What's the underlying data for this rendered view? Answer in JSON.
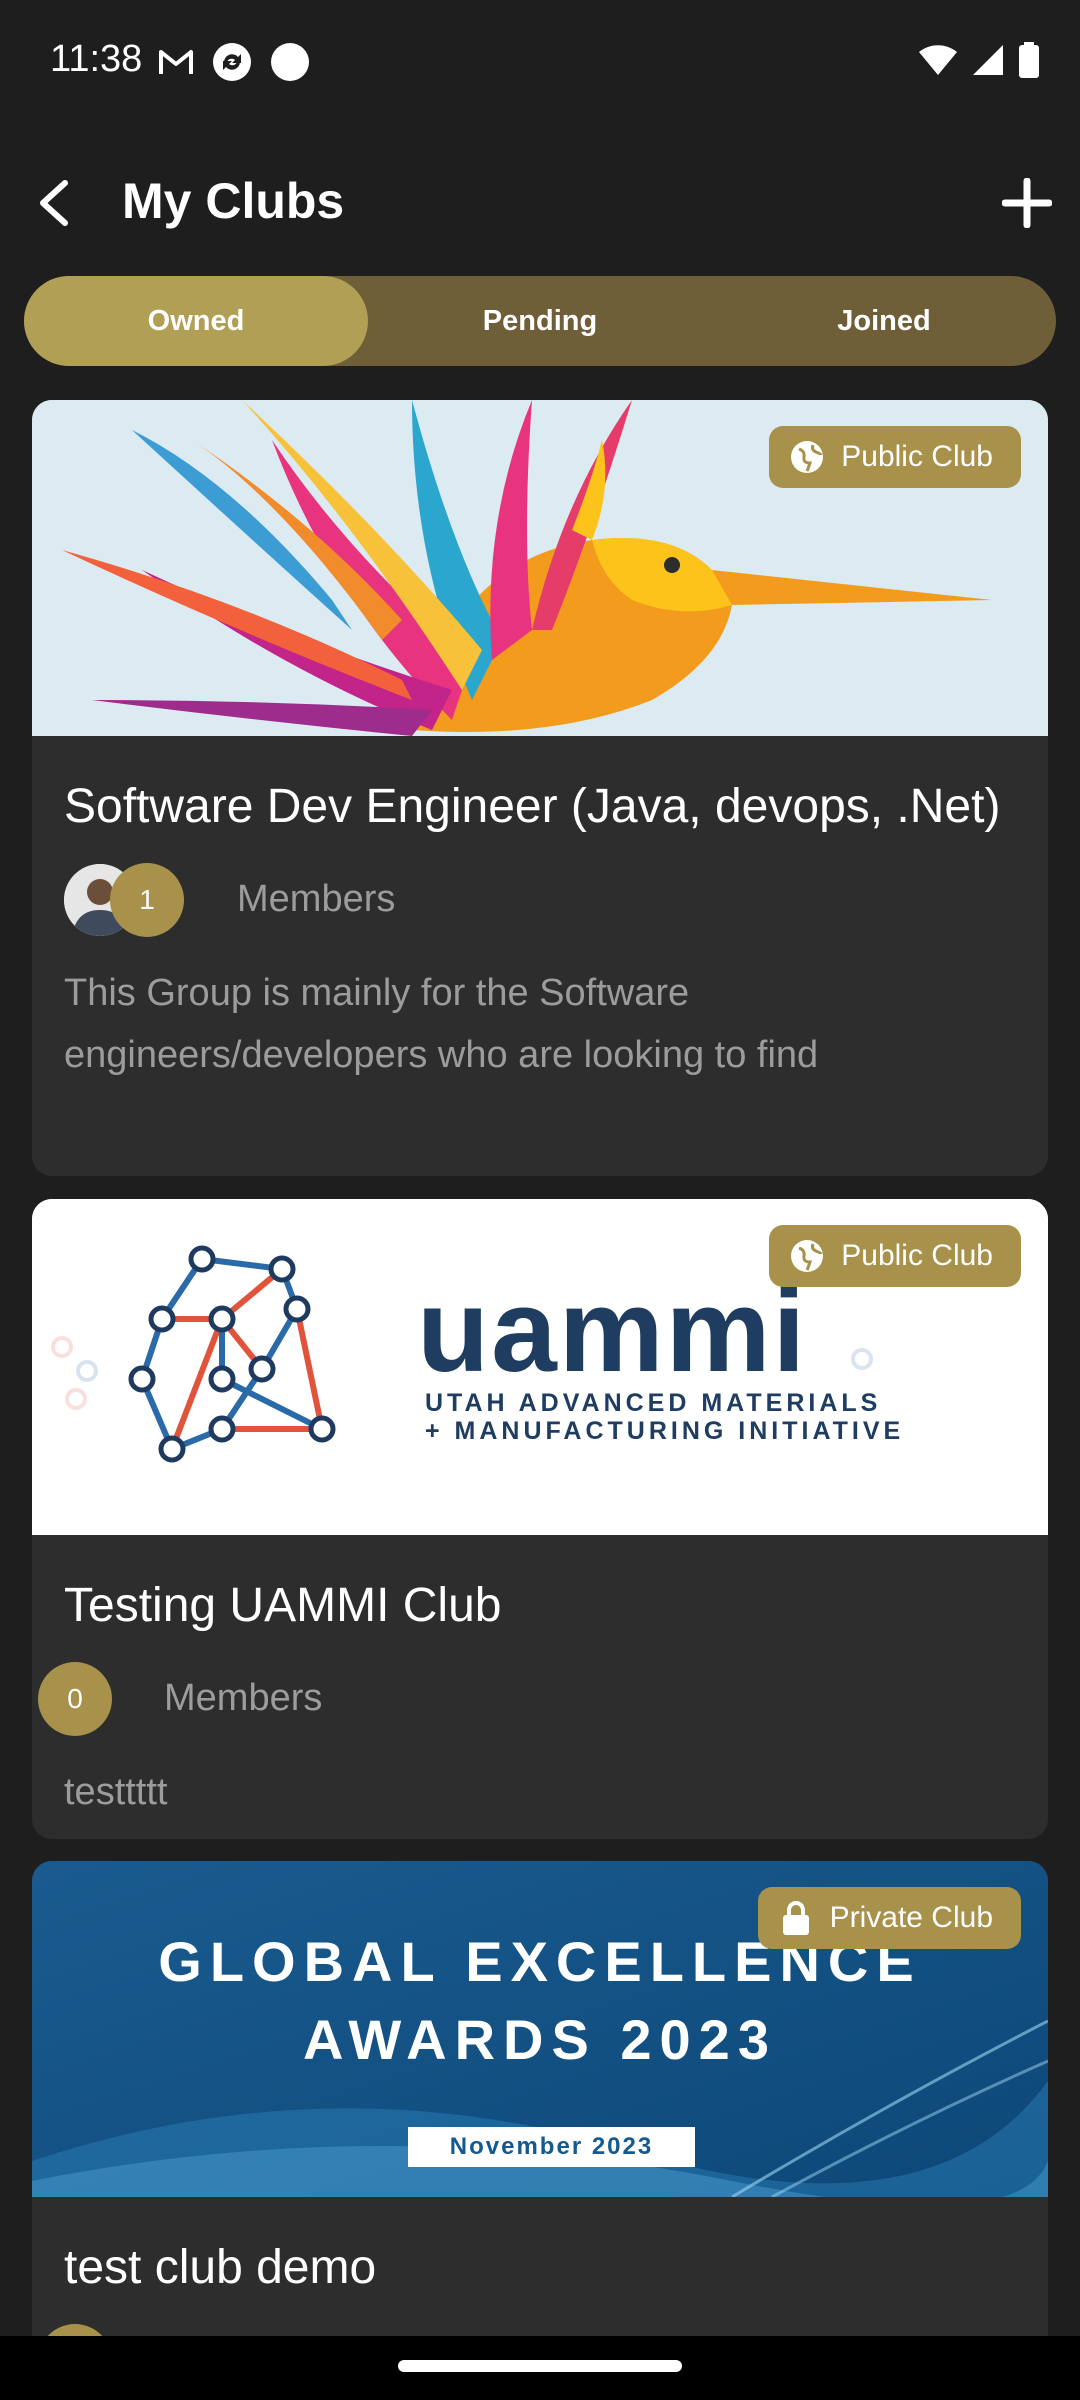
{
  "status_bar": {
    "time": "11:38",
    "left_icons": [
      "gmail-icon",
      "sync-icon",
      "dot-icon"
    ],
    "right_icons": [
      "wifi-icon",
      "signal-icon",
      "battery-icon"
    ]
  },
  "header": {
    "title": "My Clubs",
    "back_icon": "back-arrow-icon",
    "add_icon": "plus-icon"
  },
  "tabs": [
    {
      "label": "Owned",
      "active": true
    },
    {
      "label": "Pending",
      "active": false
    },
    {
      "label": "Joined",
      "active": false
    }
  ],
  "clubs": [
    {
      "title": "Software Dev Engineer (Java, devops, .Net)",
      "badge": "Public Club",
      "badge_icon": "globe-icon",
      "members_count": "1",
      "members_label": "Members",
      "description": "This  Group is mainly for the Software engineers/developers who are looking to find",
      "banner": "colorful-bird-logo"
    },
    {
      "title": "Testing UAMMI Club",
      "badge": "Public Club",
      "badge_icon": "globe-icon",
      "members_count": "0",
      "members_label": "Members",
      "description": "testtttt",
      "banner": "uammi-logo",
      "banner_text": {
        "logo_word": "uammi",
        "logo_line1": "UTAH ADVANCED MATERIALS",
        "logo_line2": "+ MANUFACTURING INITIATIVE"
      }
    },
    {
      "title": "test club demo",
      "badge": "Private Club",
      "badge_icon": "lock-icon",
      "banner": "global-excellence-awards",
      "banner_text": {
        "line1": "GLOBAL EXCELLENCE",
        "line2": "AWARDS 2023",
        "date": "November 2023"
      }
    }
  ],
  "colors": {
    "background": "#1e1e1e",
    "card": "#2d2d2d",
    "accent": "#a8914a",
    "tab_track": "#6e5f38",
    "tab_active": "#b19f55",
    "muted_text": "#9c9c9c"
  }
}
